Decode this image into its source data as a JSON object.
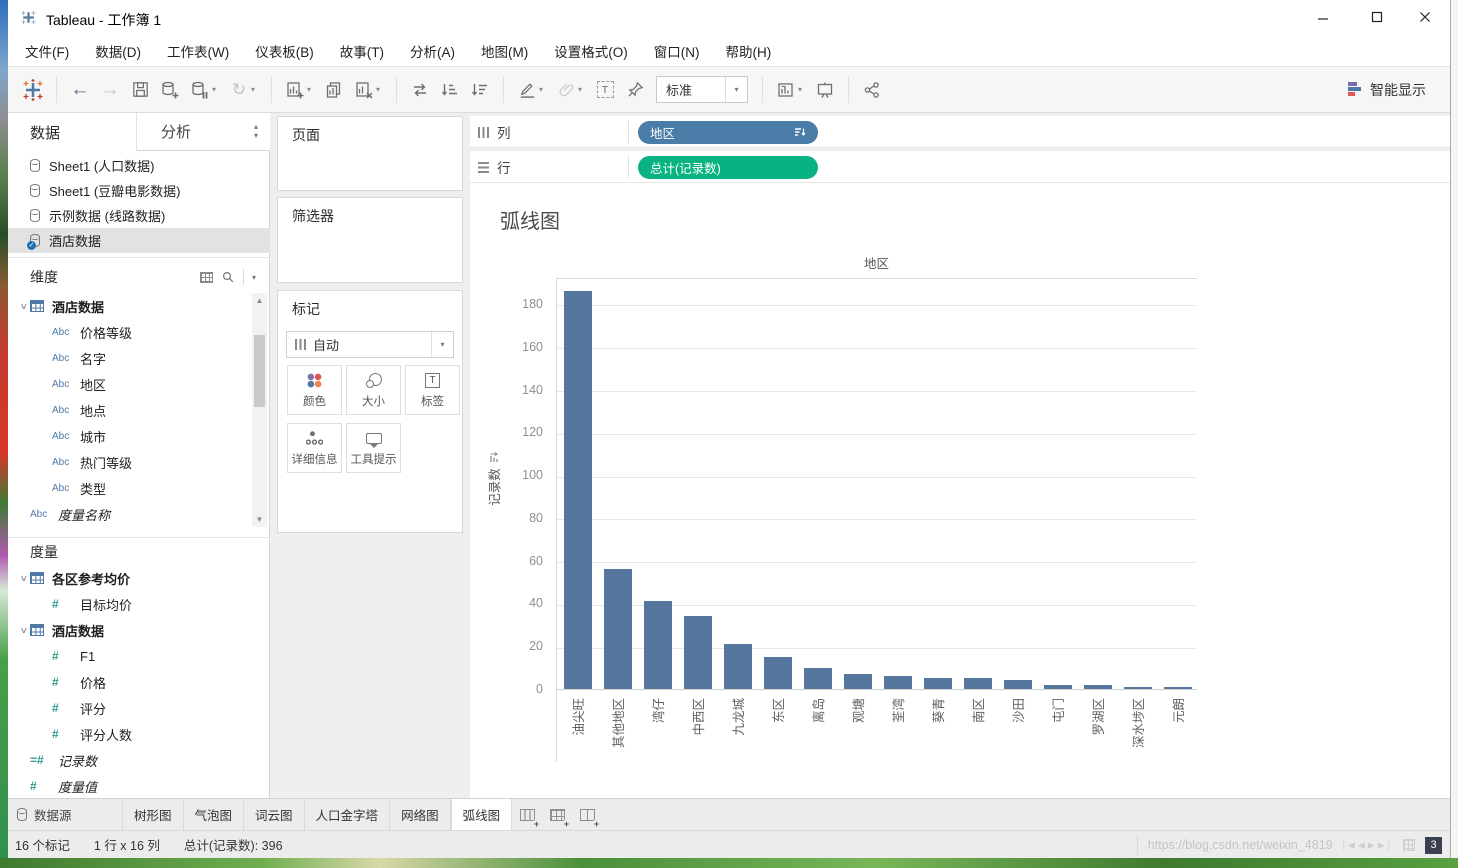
{
  "window": {
    "title": "Tableau - 工作簿 1"
  },
  "menu": {
    "items": [
      "文件(F)",
      "数据(D)",
      "工作表(W)",
      "仪表板(B)",
      "故事(T)",
      "分析(A)",
      "地图(M)",
      "设置格式(O)",
      "窗口(N)",
      "帮助(H)"
    ]
  },
  "toolbar": {
    "view_mode": "标准",
    "show_me": "智能显示"
  },
  "data_pane": {
    "tab_data": "数据",
    "tab_analytics": "分析",
    "sources": [
      {
        "label": "Sheet1 (人口数据)",
        "selected": false
      },
      {
        "label": "Sheet1 (豆瓣电影数据)",
        "selected": false
      },
      {
        "label": "示例数据 (线路数据)",
        "selected": false
      },
      {
        "label": "酒店数据",
        "selected": true
      }
    ],
    "dimensions": {
      "title": "维度",
      "rows": [
        {
          "icon": "table",
          "label": "酒店数据",
          "bold": true,
          "chevron": true,
          "level": 1
        },
        {
          "icon": "abc",
          "label": "价格等级",
          "level": 2
        },
        {
          "icon": "abc",
          "label": "名字",
          "level": 2
        },
        {
          "icon": "abc",
          "label": "地区",
          "level": 2
        },
        {
          "icon": "abc",
          "label": "地点",
          "level": 2
        },
        {
          "icon": "abc",
          "label": "城市",
          "level": 2
        },
        {
          "icon": "abc",
          "label": "热门等级",
          "level": 2
        },
        {
          "icon": "abc",
          "label": "类型",
          "level": 2
        },
        {
          "icon": "abc",
          "label": "度量名称",
          "italic": true,
          "level": 1
        }
      ]
    },
    "measures": {
      "title": "度量",
      "rows": [
        {
          "icon": "table",
          "label": "各区参考均价",
          "bold": true,
          "chevron": true,
          "level": 1
        },
        {
          "icon": "num",
          "label": "目标均价",
          "level": 2
        },
        {
          "icon": "table",
          "label": "酒店数据",
          "bold": true,
          "chevron": true,
          "level": 1
        },
        {
          "icon": "num",
          "label": "F1",
          "level": 2
        },
        {
          "icon": "num",
          "label": "价格",
          "level": 2
        },
        {
          "icon": "num",
          "label": "评分",
          "level": 2
        },
        {
          "icon": "num",
          "label": "评分人数",
          "level": 2
        },
        {
          "icon": "numeq",
          "label": "记录数",
          "italic": true,
          "level": 1
        },
        {
          "icon": "num",
          "label": "度量值",
          "italic": true,
          "level": 1
        }
      ]
    }
  },
  "cards": {
    "pages_title": "页面",
    "filters_title": "筛选器",
    "marks": {
      "title": "标记",
      "type_label": "自动",
      "buttons": [
        {
          "key": "color",
          "label": "颜色"
        },
        {
          "key": "size",
          "label": "大小"
        },
        {
          "key": "label",
          "label": "标签"
        },
        {
          "key": "detail",
          "label": "详细信息"
        },
        {
          "key": "tooltip",
          "label": "工具提示"
        }
      ]
    }
  },
  "shelves": {
    "columns_label": "列",
    "rows_label": "行",
    "column_pills": [
      {
        "label": "地区",
        "color": "#4a7ca8",
        "sorted": true
      }
    ],
    "row_pills": [
      {
        "label": "总计(记录数)",
        "color": "#09b381",
        "sorted": false
      }
    ]
  },
  "sheet": {
    "title": "弧线图"
  },
  "chart_data": {
    "type": "bar",
    "title": "弧线图",
    "column_header": "地区",
    "ylabel": "记录数",
    "categories": [
      "油尖旺",
      "其他地区",
      "湾仔",
      "中西区",
      "九龙城",
      "东区",
      "离岛",
      "观塘",
      "荃湾",
      "葵青",
      "南区",
      "沙田",
      "屯门",
      "罗湖区",
      "深水埗区",
      "元朗"
    ],
    "values": [
      186,
      56,
      41,
      34,
      21,
      15,
      10,
      7,
      6,
      5,
      5,
      4,
      2,
      2,
      1,
      1
    ],
    "yticks": [
      0,
      20,
      40,
      60,
      80,
      100,
      120,
      140,
      160,
      180
    ],
    "ylim": [
      0,
      193
    ],
    "grid": true,
    "legend": "none",
    "bar_color": "#55779e",
    "total_records": 396
  },
  "bottom_tabs": {
    "datasource": "数据源",
    "tabs": [
      {
        "label": "树形图",
        "active": false
      },
      {
        "label": "气泡图",
        "active": false
      },
      {
        "label": "词云图",
        "active": false
      },
      {
        "label": "人口金字塔",
        "active": false
      },
      {
        "label": "网络图",
        "active": false
      },
      {
        "label": "弧线图",
        "active": true
      }
    ]
  },
  "status": {
    "marks": "16 个标记",
    "grid_size": "1 行 x 16 列",
    "aggregate": "总计(记录数): 396",
    "watermark": "https://blog.csdn.net/weixin_4819",
    "badge": "3"
  }
}
